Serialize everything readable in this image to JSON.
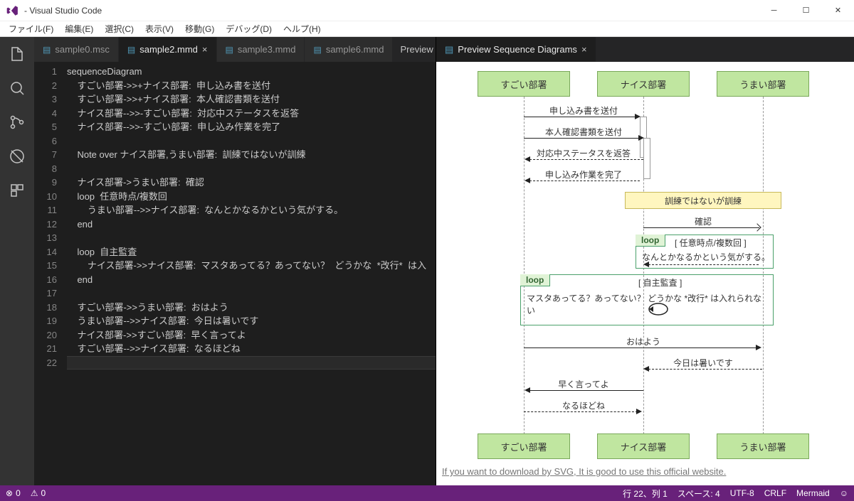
{
  "window": {
    "title": "- Visual Studio Code"
  },
  "menu": [
    "ファイル(F)",
    "編集(E)",
    "選択(C)",
    "表示(V)",
    "移動(G)",
    "デバッグ(D)",
    "ヘルプ(H)"
  ],
  "tabs_left": [
    {
      "label": "sample0.msc",
      "active": false
    },
    {
      "label": "sample2.mmd",
      "active": true
    },
    {
      "label": "sample3.mmd",
      "active": false
    },
    {
      "label": "sample6.mmd",
      "active": false
    }
  ],
  "tab_actions": {
    "preview": "Preview"
  },
  "preview_tab": {
    "label": "Preview Sequence Diagrams"
  },
  "code": {
    "lines": [
      "sequenceDiagram",
      "    すごい部署->>+ナイス部署:  申し込み書を送付",
      "    すごい部署->>+ナイス部署:  本人確認書類を送付",
      "    ナイス部署-->>-すごい部署:  対応中ステータスを返答",
      "    ナイス部署-->>-すごい部署:  申し込み作業を完了",
      "",
      "    Note over ナイス部署,うまい部署:  訓練ではないが訓練",
      "",
      "    ナイス部署->うまい部署:  確認",
      "    loop  任意時点/複数回",
      "        うまい部署-->>ナイス部署:  なんとかなるかという気がする。",
      "    end",
      "",
      "    loop  自主監査",
      "        ナイス部署->>ナイス部署:  マスタあってる？あってない？  どうかな  *改行*  は入",
      "    end",
      "",
      "    すごい部署->>うまい部署:  おはよう",
      "    うまい部署-->>ナイス部署:  今日は暑いです",
      "    ナイス部署->>すごい部署:  早く言ってよ",
      "    すごい部署-->>ナイス部署:  なるほどね",
      ""
    ]
  },
  "diagram": {
    "participants": [
      "すごい部署",
      "ナイス部署",
      "うまい部署"
    ],
    "messages": {
      "m1": "申し込み書を送付",
      "m2": "本人確認書類を送付",
      "m3": "対応中ステータスを返答",
      "m4": "申し込み作業を完了",
      "note": "訓練ではないが訓練",
      "m5": "確認",
      "loop1_label": "[ 任意時点/複数回 ]",
      "loop1_msg": "なんとかなるかという気がする。",
      "loop2_label": "[ 自主監査 ]",
      "loop2_msg": "マスタあってる？あってない？  どうかな *改行* は入れられない",
      "m6": "おはよう",
      "m7": "今日は暑いです",
      "m8": "早く言ってよ",
      "m9": "なるほどね",
      "loop_word": "loop"
    },
    "footer_link": "If you want to download by SVG, It is good to use this official website."
  },
  "status": {
    "errors": "0",
    "warnings": "0",
    "line_col": "行 22、列 1",
    "spaces": "スペース: 4",
    "encoding": "UTF-8",
    "eol": "CRLF",
    "lang": "Mermaid"
  }
}
